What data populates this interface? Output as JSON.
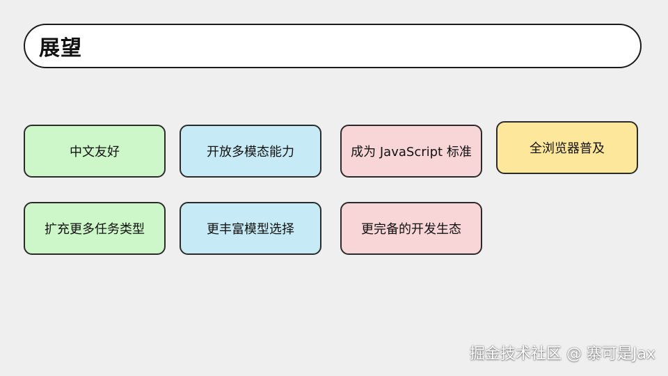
{
  "header": {
    "title": "展望"
  },
  "cards": [
    {
      "label": "中文友好",
      "color": "#cdf6c9"
    },
    {
      "label": "开放多模态能力",
      "color": "#c7ebf6"
    },
    {
      "label": "成为 JavaScript 标准",
      "color": "#f8d5d7"
    },
    {
      "label": "全浏览器普及",
      "color": "#fde79a"
    },
    {
      "label": "扩充更多任务类型",
      "color": "#cdf6c9"
    },
    {
      "label": "更丰富模型选择",
      "color": "#c7ebf6"
    },
    {
      "label": "更完备的开发生态",
      "color": "#f8d5d7"
    }
  ],
  "watermark": {
    "text": "掘金技术社区 @ 寨可是Jax"
  }
}
